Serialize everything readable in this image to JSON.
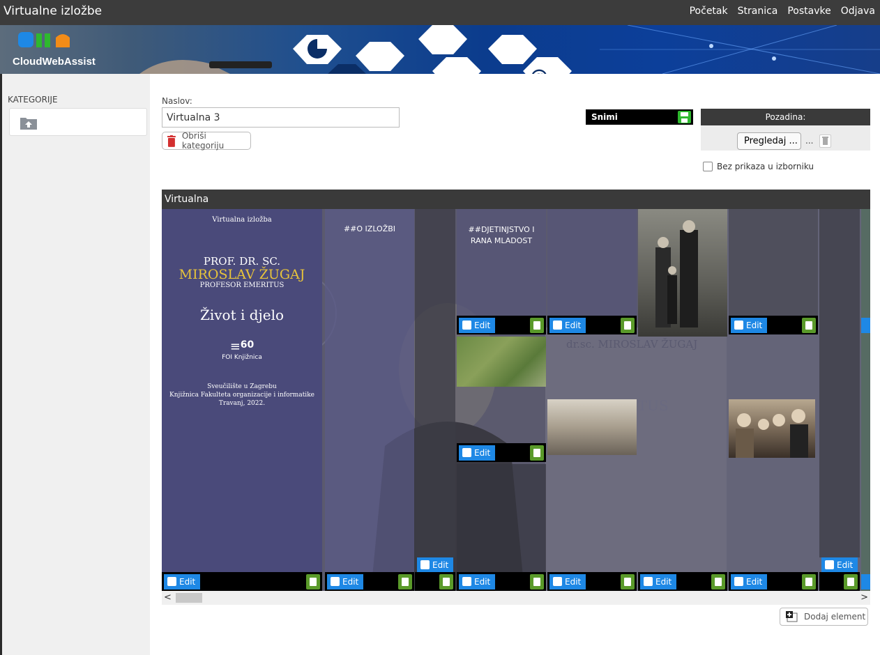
{
  "app": {
    "title": "Virtualne izložbe"
  },
  "topnav": [
    "Početak",
    "Stranica",
    "Postavke",
    "Odjava"
  ],
  "banner": {
    "logo_text": "CloudWebAssist",
    "logo_letters": "CWA"
  },
  "sidebar": {
    "heading": "KATEGORIJE"
  },
  "form": {
    "naslov_label": "Naslov:",
    "naslov_value": "Virtualna 3",
    "delete_category_label": "Obriši kategoriju",
    "save_label": "Snimi",
    "pozadina_label": "Pozadina:",
    "browse_label": "Pregledaj ...",
    "browse_dots": "...",
    "checkbox_label": "Bez prikaza u izborniku",
    "checkbox_checked": false
  },
  "gallery": {
    "title": "Virtualna",
    "edit_label": "Edit",
    "cover": {
      "subtitle": "Virtualna izložba",
      "line1": "PROF. DR. SC.",
      "name": "MIROSLAV ŽUGAJ",
      "line3": "PROFESOR EMERITUS",
      "heading": "Život i djelo",
      "badge_number": "60",
      "badge_text": "FOI Knjižnica",
      "footer1": "Sveučilište u Zagrebu",
      "footer2": "Knjižnica Fakulteta organizacije i informatike",
      "footer3": "Travanj, 2022."
    },
    "col2_title": "##O IZLOŽBI",
    "col4_title": "##DJETINJSTVO I RANA MLADOST",
    "bg_text1": "dr.sc. MIROSLAV ŽUGAJ",
    "bg_text2": "EMERITUS"
  },
  "add_element_label": "Dodaj element",
  "colors": {
    "accent_blue": "#1e88e5",
    "trash_green": "#5a9a2a",
    "save_green": "#2eb82e",
    "gold": "#e8c43a"
  }
}
